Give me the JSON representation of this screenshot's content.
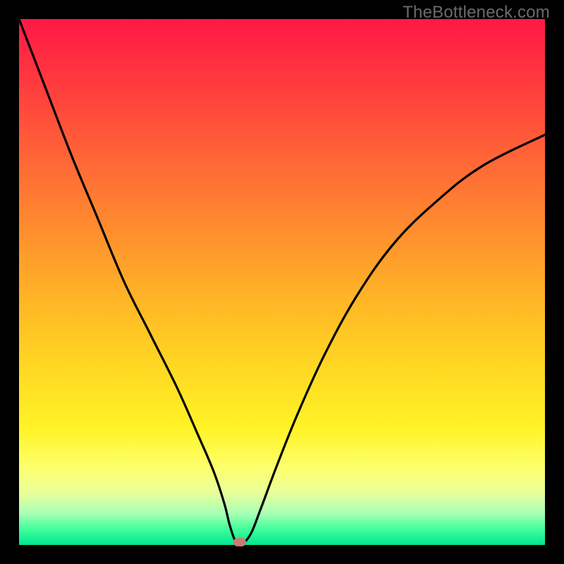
{
  "watermark": "TheBottleneck.com",
  "chart_data": {
    "type": "line",
    "title": "",
    "xlabel": "",
    "ylabel": "",
    "xlim": [
      0,
      100
    ],
    "ylim": [
      0,
      100
    ],
    "grid": false,
    "legend": false,
    "annotations": [
      {
        "kind": "marker",
        "shape": "rounded-rect",
        "color": "#cb7a72",
        "x": 42,
        "y": 0
      }
    ],
    "series": [
      {
        "name": "bottleneck-curve",
        "color": "#000000",
        "x": [
          0,
          5,
          10,
          15,
          20,
          25,
          30,
          34,
          37,
          39,
          40,
          41,
          42,
          44,
          46,
          49,
          53,
          58,
          64,
          71,
          79,
          88,
          100
        ],
        "y": [
          100,
          87,
          74,
          62,
          50,
          40,
          30,
          21,
          14,
          8,
          4,
          1,
          0,
          2,
          7,
          15,
          25,
          36,
          47,
          57,
          65,
          72,
          78
        ]
      }
    ],
    "background_gradient_stops": [
      {
        "pos": 0.0,
        "color": "#ff1846"
      },
      {
        "pos": 0.12,
        "color": "#ff3a3e"
      },
      {
        "pos": 0.28,
        "color": "#ff6a36"
      },
      {
        "pos": 0.42,
        "color": "#ff932d"
      },
      {
        "pos": 0.54,
        "color": "#ffb726"
      },
      {
        "pos": 0.66,
        "color": "#ffd722"
      },
      {
        "pos": 0.78,
        "color": "#fff427"
      },
      {
        "pos": 0.85,
        "color": "#fdff6a"
      },
      {
        "pos": 0.9,
        "color": "#eaff9a"
      },
      {
        "pos": 0.94,
        "color": "#a8ffb6"
      },
      {
        "pos": 0.97,
        "color": "#40ff9b"
      },
      {
        "pos": 1.0,
        "color": "#00e58e"
      }
    ]
  }
}
